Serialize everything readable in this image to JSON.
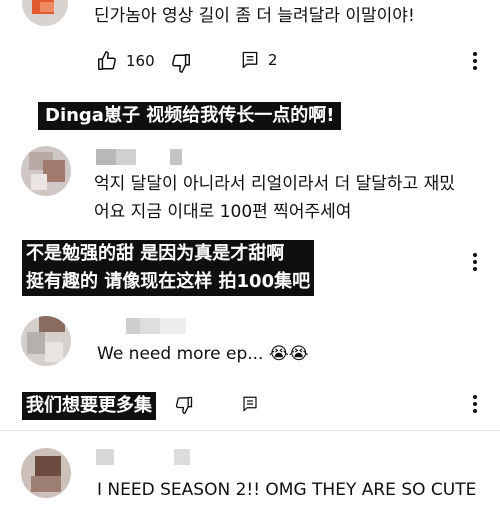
{
  "comments": [
    {
      "text_lines": [
        "딘가놈아 영상 길이 좀 더 늘려달라 이말이야!"
      ],
      "likes": "160",
      "replies": "2",
      "caption_lines": [
        "Dinga崽子 视频给我传长一点的啊!"
      ]
    },
    {
      "text_lines": [
        "억지 달달이 아니라서 리얼이라서 더 달달하고 재밌",
        "어요 지금 이대로 100편 찍어주세여"
      ],
      "caption_lines": [
        "不是勉强的甜  是因为真是才甜啊",
        "挺有趣的 请像现在这样 拍100集吧"
      ]
    },
    {
      "text_lines": [
        "We need more ep... 😭😭"
      ],
      "caption_lines": [
        "我们想要更多集"
      ]
    },
    {
      "text_lines": [
        "I NEED SEASON 2!! OMG THEY ARE SO CUTE"
      ]
    }
  ],
  "icons": {
    "like": "thumbs-up-icon",
    "dislike": "thumbs-down-icon",
    "reply": "reply-icon",
    "more": "more-vert-icon",
    "cry": "loudly-crying-face-emoji"
  },
  "colors": {
    "caption_bg": "#0f0f0f",
    "caption_text": "#ffffff",
    "text": "#0f0f0f"
  }
}
